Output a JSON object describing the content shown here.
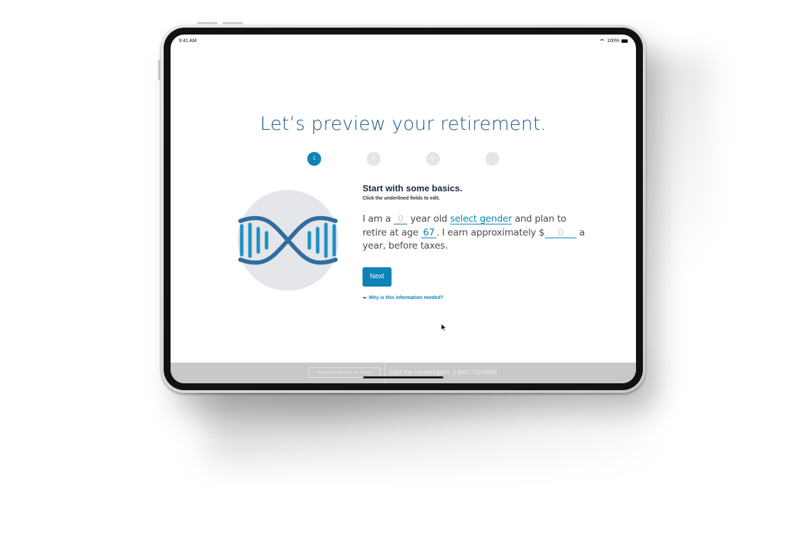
{
  "status_bar": {
    "time": "9:41 AM",
    "battery": "100%"
  },
  "page": {
    "title": "Let’s preview your retirement.",
    "steps": [
      {
        "label": "1",
        "active": true
      },
      {
        "label": "2",
        "active": false
      },
      {
        "label": "3",
        "active": false
      },
      {
        "label": "",
        "active": false
      }
    ]
  },
  "form": {
    "heading": "Start with some basics.",
    "subheading": "Click the underlined fields to edit.",
    "sentence": {
      "part1": "I am a",
      "age_value": "0",
      "part2": "year old",
      "gender_value": "select gender",
      "part3": "and plan to retire at age",
      "retire_age_value": "67",
      "part4": ". I earn approximately $",
      "income_value": "0",
      "part5": "a year, before taxes."
    },
    "next_label": "Next",
    "why_link": "Why is this information needed?"
  },
  "footer": {
    "button_label": "Request a call from an advisor",
    "text": "Start the conversation. 1-844-715-6006"
  },
  "colors": {
    "accent": "#0d83b6",
    "title": "#1f5a8e",
    "step_inactive": "#e6e4e8",
    "footer_bg": "#c8c8c8"
  }
}
